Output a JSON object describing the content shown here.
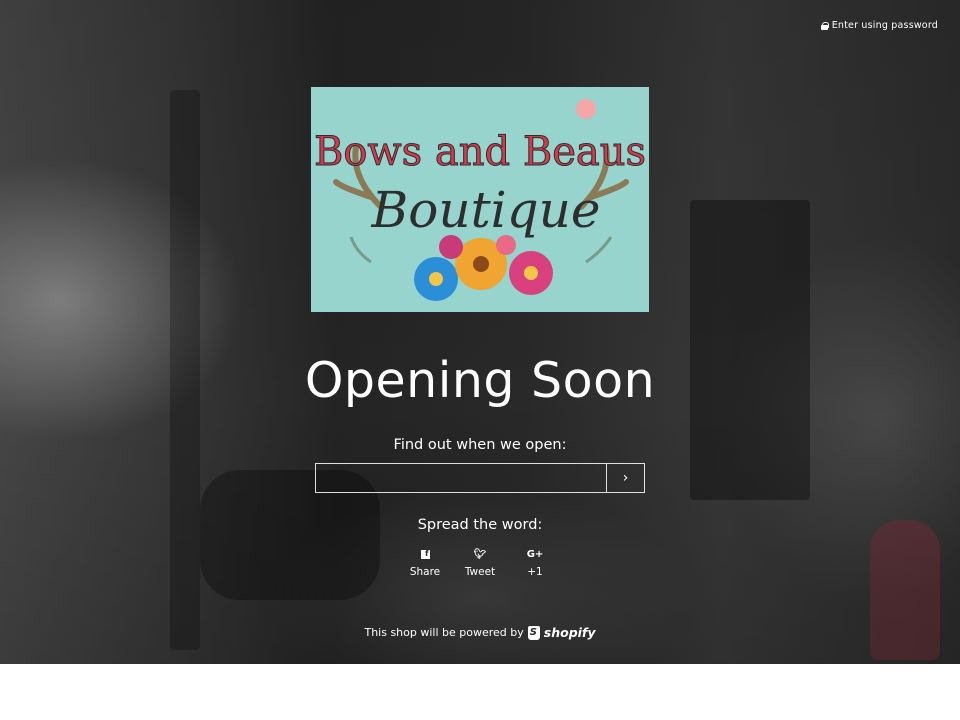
{
  "header": {
    "password_link": "Enter using password"
  },
  "logo": {
    "line1": "Bows and Beaus",
    "line2": "Boutique"
  },
  "main": {
    "title": "Opening Soon",
    "signup_label": "Find out when we open:",
    "email": {
      "value": "",
      "placeholder": ""
    },
    "submit_icon": "chevron-right-icon",
    "submit_glyph": "›"
  },
  "share": {
    "heading": "Spread the word:",
    "items": [
      {
        "label": "Share",
        "icon": "facebook-icon"
      },
      {
        "label": "Tweet",
        "icon": "twitter-icon",
        "glyph": "🐦︎"
      },
      {
        "label": "+1",
        "icon": "google-plus-icon",
        "glyph": "G+"
      }
    ]
  },
  "footer": {
    "powered_text": "This shop will be powered by",
    "brand": "shopify"
  },
  "colors": {
    "logo_bg": "#96d4cd",
    "logo_red": "#d9384a",
    "logo_dark": "#2e2e2e",
    "page_bg": "#2b2b2b"
  }
}
